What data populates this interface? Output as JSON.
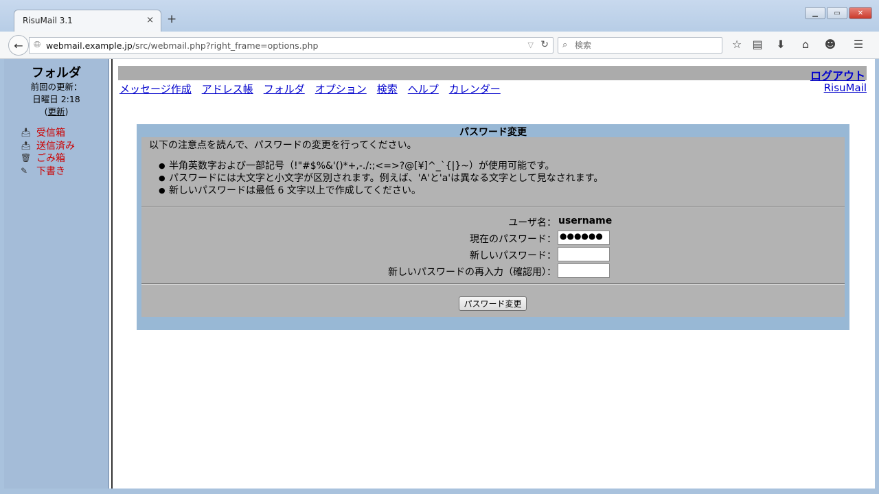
{
  "window": {
    "tab_title": "RisuMail 3.1",
    "tab_close": "×",
    "new_tab": "+",
    "controls": {
      "minimize": "▁",
      "maximize": "▭",
      "close": "✕"
    }
  },
  "navbar": {
    "url_host": "webmail.example.jp",
    "url_path": "/src/webmail.php?right_frame=options.php",
    "search_placeholder": "検索",
    "icons": [
      "back-arrow-icon",
      "globe-icon",
      "reload-icon",
      "search-icon",
      "bookmark-star-icon",
      "reading-list-icon",
      "download-icon",
      "home-icon",
      "chat-icon",
      "menu-icon"
    ]
  },
  "sidebar": {
    "title": "フォルダ",
    "last_update_label": "前回の更新：",
    "last_update_time": "日曜日 2:18",
    "refresh_open": "(",
    "refresh_label": "更新",
    "refresh_close": ")",
    "folders": [
      {
        "label": "受信箱",
        "icon": "inbox-icon"
      },
      {
        "label": "送信済み",
        "icon": "sent-icon"
      },
      {
        "label": "ごみ箱",
        "icon": "trash-icon"
      },
      {
        "label": "下書き",
        "icon": "drafts-icon"
      }
    ]
  },
  "header": {
    "logout": "ログアウト",
    "brand": "RisuMail",
    "menu": [
      "メッセージ作成",
      "アドレス帳",
      "フォルダ",
      "オプション",
      "検索",
      "ヘルプ",
      "カレンダー"
    ]
  },
  "password_panel": {
    "title": "パスワード変更",
    "intro": "以下の注意点を読んで、パスワードの変更を行ってください。",
    "notes": [
      "半角英数字および一部記号（!\"#$%&'()*+,-./:;<=>?@[¥]^_`{|}~）が使用可能です。",
      "パスワードには大文字と小文字が区別されます。例えば、'A'と'a'は異なる文字として見なされます。",
      "新しいパスワードは最低 6 文字以上で作成してください。"
    ],
    "username_label": "ユーザ名：",
    "username_value": "username",
    "current_password_label": "現在のパスワード：",
    "current_password_value": "●●●●●●",
    "new_password_label": "新しいパスワード：",
    "new_password_value": "",
    "confirm_password_label": "新しいパスワードの再入力（確認用）：",
    "confirm_password_value": "",
    "submit_label": "パスワード変更"
  }
}
